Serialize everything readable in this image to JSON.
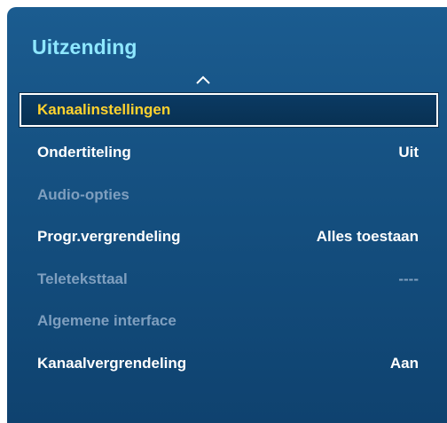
{
  "menu": {
    "title": "Uitzending",
    "scroll_up_icon": "chevron-up-icon",
    "items": [
      {
        "label": "Kanaalinstellingen",
        "value": "",
        "state": "selected"
      },
      {
        "label": "Ondertiteling",
        "value": "Uit",
        "state": "enabled"
      },
      {
        "label": "Audio-opties",
        "value": "",
        "state": "disabled"
      },
      {
        "label": "Progr.vergrendeling",
        "value": "Alles toestaan",
        "state": "enabled"
      },
      {
        "label": "Teleteksttaal",
        "value": "----",
        "state": "disabled"
      },
      {
        "label": "Algemene interface",
        "value": "",
        "state": "disabled"
      },
      {
        "label": "Kanaalvergrendeling",
        "value": "Aan",
        "state": "enabled"
      }
    ]
  },
  "colors": {
    "panel_background": "#165283",
    "title": "#8ee7ff",
    "selected_label": "#ffd22e",
    "enabled_text": "#ffffff",
    "disabled_text": "#7f9fbf"
  }
}
